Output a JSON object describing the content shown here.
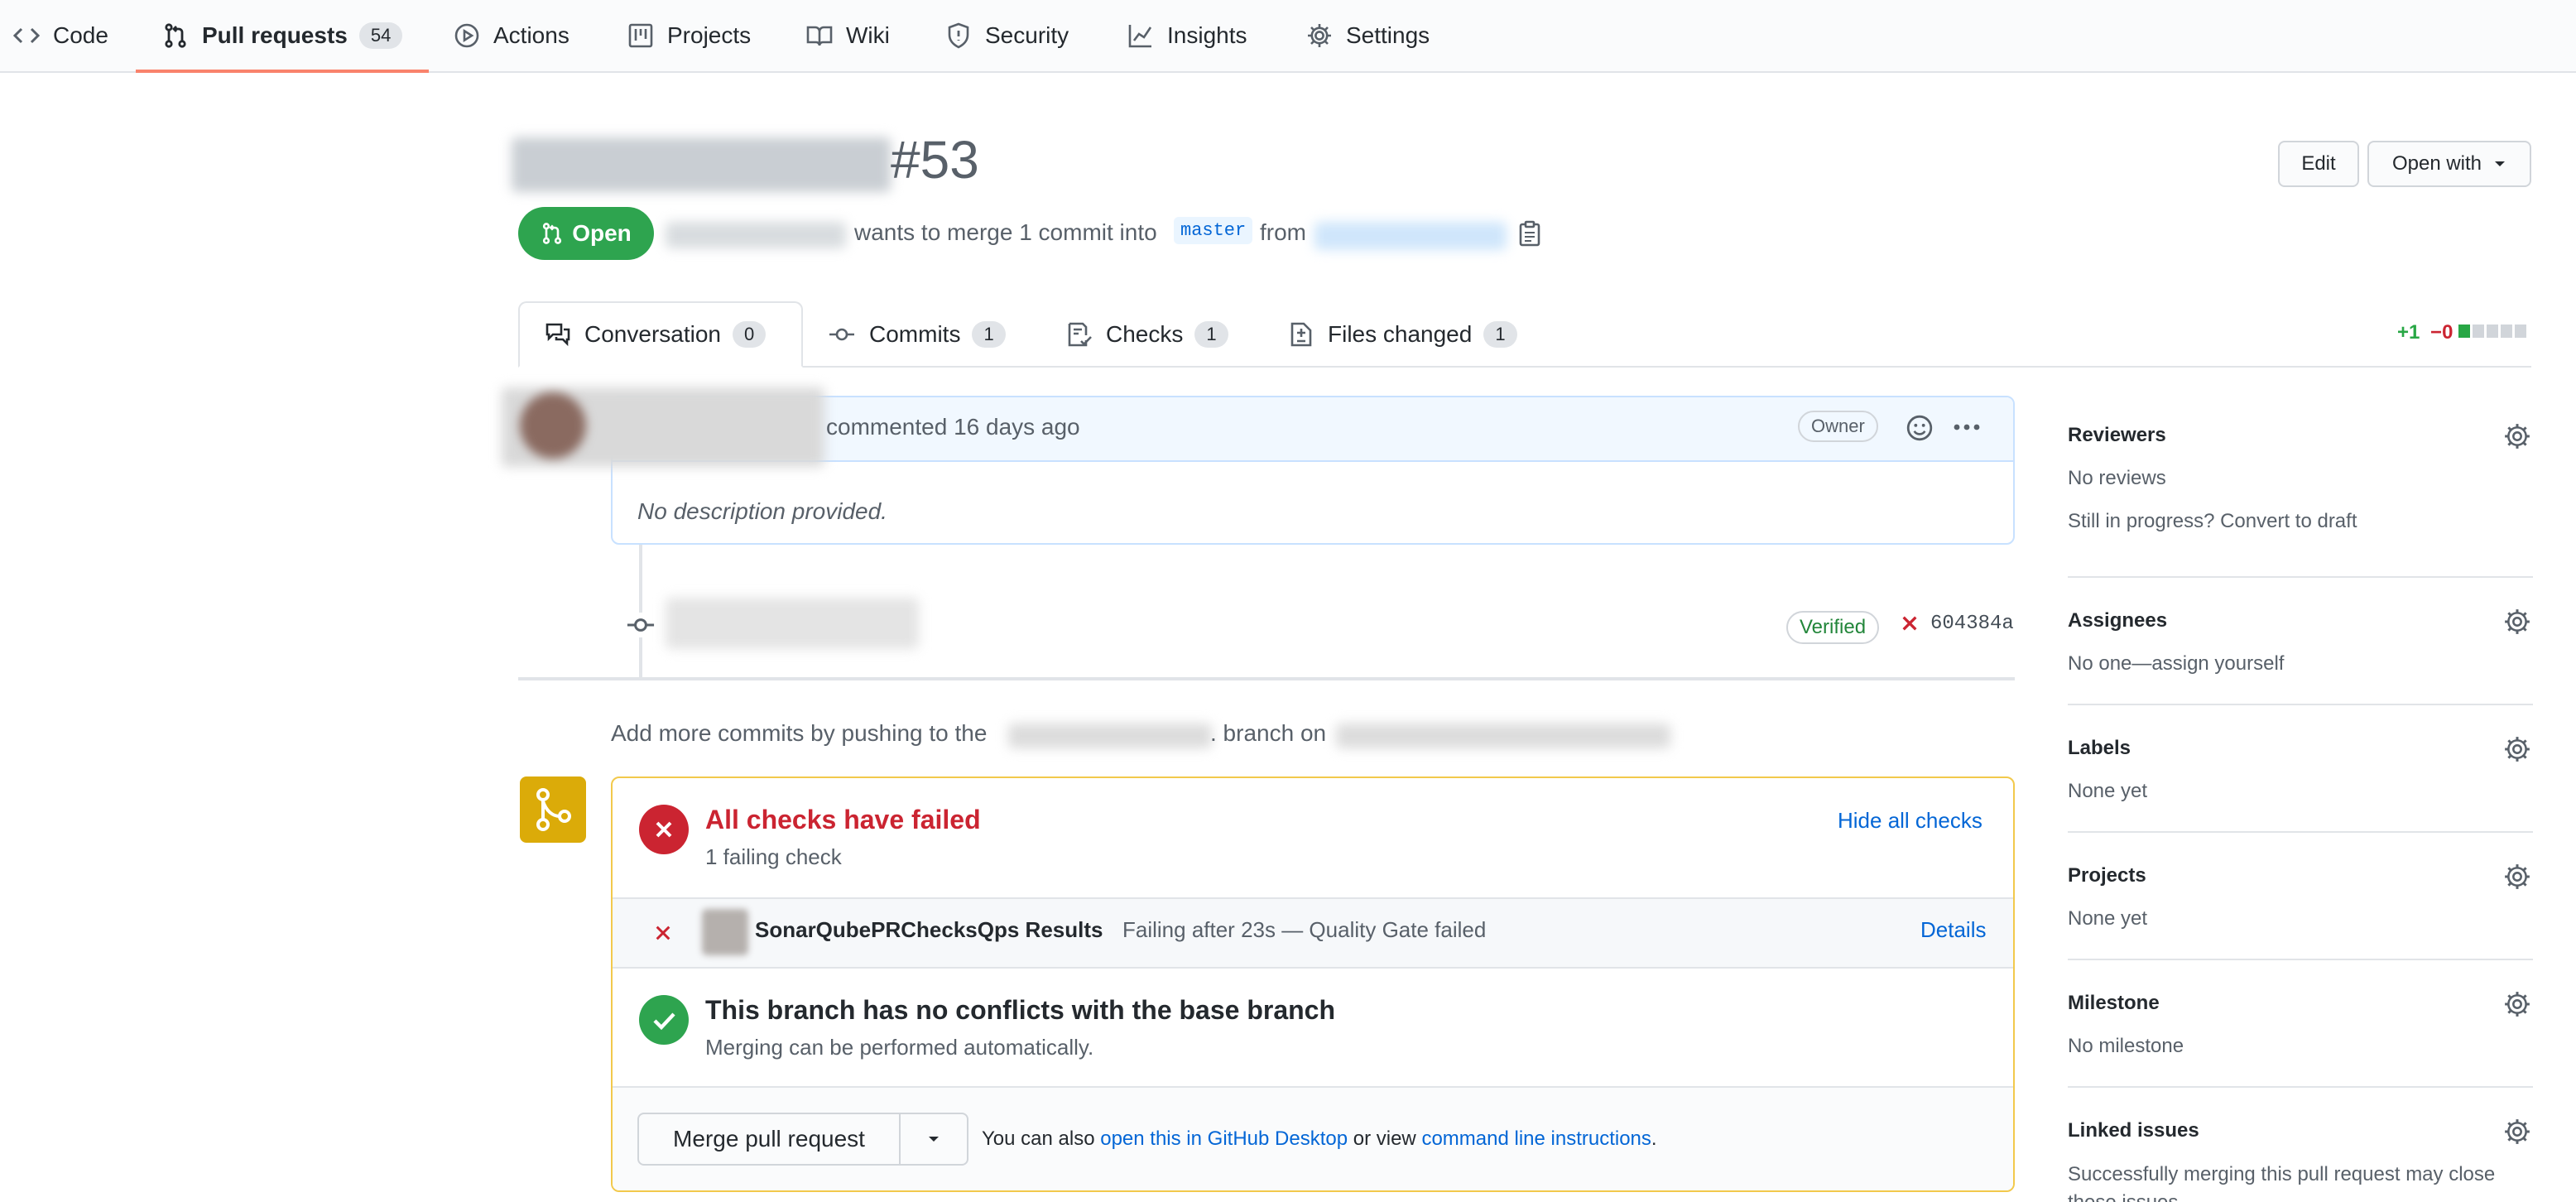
{
  "nav": {
    "items": [
      {
        "label": "Code",
        "icon": "code-icon"
      },
      {
        "label": "Pull requests",
        "icon": "git-pull-request-icon",
        "count": "54"
      },
      {
        "label": "Actions",
        "icon": "play-icon"
      },
      {
        "label": "Projects",
        "icon": "project-icon"
      },
      {
        "label": "Wiki",
        "icon": "book-icon"
      },
      {
        "label": "Security",
        "icon": "shield-icon"
      },
      {
        "label": "Insights",
        "icon": "graph-icon"
      },
      {
        "label": "Settings",
        "icon": "gear-icon"
      }
    ]
  },
  "pr": {
    "number": "#53",
    "state": "Open",
    "merge_text_1": "wants to merge 1 commit into",
    "base_branch": "master",
    "from_text": "from",
    "edit_label": "Edit",
    "open_with_label": "Open with"
  },
  "tabs": [
    {
      "label": "Conversation",
      "count": "0"
    },
    {
      "label": "Commits",
      "count": "1"
    },
    {
      "label": "Checks",
      "count": "1"
    },
    {
      "label": "Files changed",
      "count": "1"
    }
  ],
  "diffstat": {
    "additions": "+1",
    "deletions": "−0"
  },
  "comment": {
    "action_text": "commented 16 days ago",
    "badge": "Owner",
    "body": "No description provided."
  },
  "commit": {
    "verified": "Verified",
    "sha": "604384a"
  },
  "push_hint": {
    "text_1": "Add more commits by pushing to the",
    "text_2": ". branch on"
  },
  "checks": {
    "title": "All checks have failed",
    "subtitle": "1 failing check",
    "hide_label": "Hide all checks",
    "check_name": "SonarQubePRChecksQps Results",
    "check_status": "Failing after 23s — Quality Gate failed",
    "details_label": "Details"
  },
  "merge": {
    "title": "This branch has no conflicts with the base branch",
    "subtitle": "Merging can be performed automatically.",
    "button_label": "Merge pull request",
    "also_text": "You can also",
    "desktop_link": "open this in GitHub Desktop",
    "or_view": "or view",
    "cli_link": "command line instructions",
    "period": "."
  },
  "sidebar": {
    "reviewers": {
      "heading": "Reviewers",
      "value": "No reviews",
      "hint": "Still in progress? Convert to draft"
    },
    "assignees": {
      "heading": "Assignees",
      "value": "No one—assign yourself"
    },
    "labels": {
      "heading": "Labels",
      "value": "None yet"
    },
    "projects": {
      "heading": "Projects",
      "value": "None yet"
    },
    "milestone": {
      "heading": "Milestone",
      "value": "No milestone"
    },
    "linked_issues": {
      "heading": "Linked issues",
      "value": "Successfully merging this pull request may close these issues."
    }
  },
  "colors": {
    "green": "#2ea44f",
    "red": "#cb2431",
    "link": "#0366d6",
    "warning_border": "#f2c94c",
    "merge_icon_bg": "#dbab09"
  }
}
